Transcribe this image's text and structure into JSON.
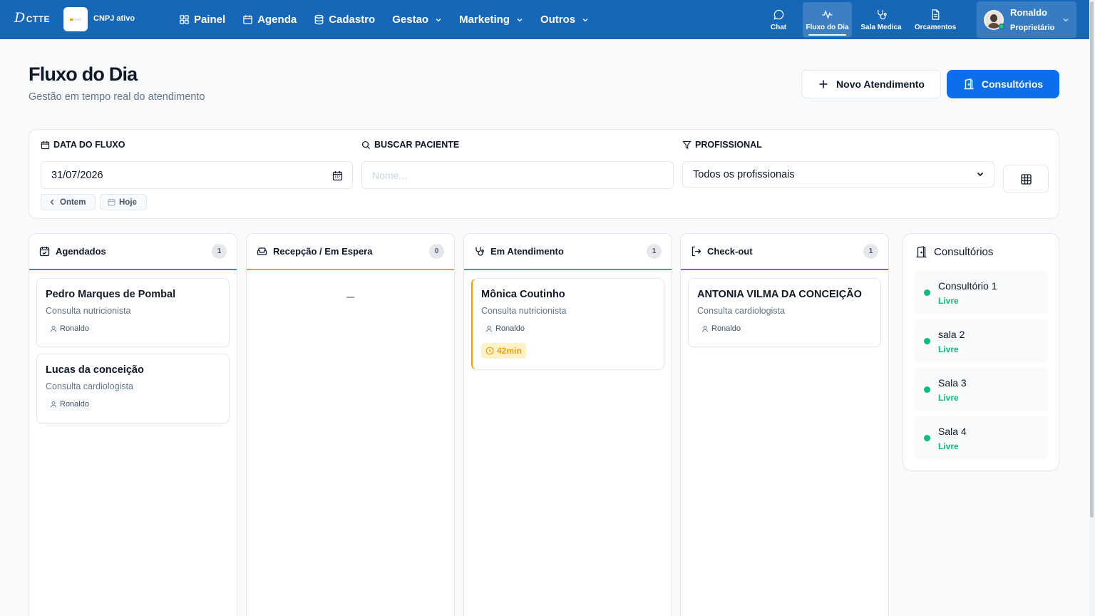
{
  "header": {
    "logo_main": "D",
    "logo_suffix": "CTTE",
    "org_status": "CNPJ ativo",
    "nav": [
      {
        "label": "Painel",
        "icon": "grid-icon"
      },
      {
        "label": "Agenda",
        "icon": "calendar-icon"
      },
      {
        "label": "Cadastro",
        "icon": "database-icon"
      },
      {
        "label": "Gestao",
        "icon": "chevron-down-icon"
      },
      {
        "label": "Marketing",
        "icon": "chevron-down-icon"
      },
      {
        "label": "Outros",
        "icon": "chevron-down-icon"
      }
    ],
    "quick_links": [
      {
        "label": "Chat",
        "icon": "chat-icon"
      },
      {
        "label": "Fluxo do Dia",
        "icon": "activity-icon",
        "active": true
      },
      {
        "label": "Sala Medica",
        "icon": "stethoscope-icon"
      },
      {
        "label": "Orcamentos",
        "icon": "document-icon"
      }
    ],
    "user": {
      "name": "Ronaldo",
      "role": "Proprietário",
      "online_color": "#22c55e"
    }
  },
  "page": {
    "title": "Fluxo do Dia",
    "subtitle": "Gestão em tempo real do atendimento",
    "new_button": "Novo Atendimento",
    "rooms_button": "Consultórios"
  },
  "filters": {
    "date_label": "DATA DO FLUXO",
    "date_value": "31/07/2026",
    "search_label": "BUSCAR PACIENTE",
    "search_placeholder": "Nome...",
    "professional_label": "PROFISSIONAL",
    "professional_value": "Todos os profissionais",
    "yesterday": "Ontem",
    "today": "Hoje"
  },
  "columns": [
    {
      "title": "Agendados",
      "count": "1",
      "color": "#3b82f6",
      "icon": "calendar-check-icon",
      "cards": [
        {
          "name": "Pedro Marques de Pombal",
          "type": "Consulta nutricionista",
          "professional": "Ronaldo"
        },
        {
          "name": "Lucas da conceição",
          "type": "Consulta cardiologista",
          "professional": "Ronaldo"
        }
      ]
    },
    {
      "title": "Recepção / Em Espera",
      "count": "0",
      "color": "#f59e0b",
      "icon": "armchair-icon",
      "cards": []
    },
    {
      "title": "Em Atendimento",
      "count": "1",
      "color": "#10b981",
      "icon": "stethoscope-icon",
      "cards": [
        {
          "name": "Mônica Coutinho",
          "type": "Consulta nutricionista",
          "professional": "Ronaldo",
          "elapsed": "42min"
        }
      ]
    },
    {
      "title": "Check-out",
      "count": "1",
      "color": "#8b5cf6",
      "icon": "logout-icon",
      "cards": [
        {
          "name": "ANTONIA VILMA DA CONCEIÇÃO",
          "type": "Consulta cardiologista",
          "professional": "Ronaldo"
        }
      ]
    }
  ],
  "rooms": {
    "title": "Consultórios",
    "status_color": "#10b981",
    "items": [
      {
        "name": "Consultório 1",
        "status": "Livre"
      },
      {
        "name": "sala 2",
        "status": "Livre"
      },
      {
        "name": "Sala 3",
        "status": "Livre"
      },
      {
        "name": "Sala 4",
        "status": "Livre"
      }
    ]
  }
}
